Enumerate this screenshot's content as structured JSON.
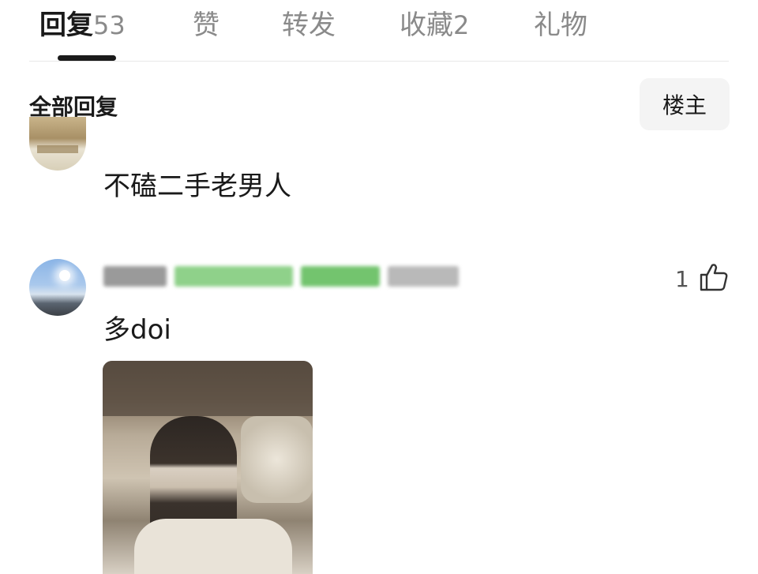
{
  "tabs": [
    {
      "label": "回复",
      "count": "53",
      "active": true
    },
    {
      "label": "赞",
      "count": "",
      "active": false
    },
    {
      "label": "转发",
      "count": "",
      "active": false
    },
    {
      "label": "收藏",
      "count": "2",
      "active": false
    },
    {
      "label": "礼物",
      "count": "",
      "active": false
    }
  ],
  "section": {
    "title": "全部回复",
    "op_button": "楼主"
  },
  "comments": [
    {
      "text": "不磕二手老男人",
      "likes": ""
    },
    {
      "text": "多doi",
      "likes": "1",
      "like_icon": "thumbs-up-icon"
    }
  ],
  "colors": {
    "active_tab": "#1a1a1a",
    "inactive_tab": "#8a8a8a",
    "button_bg": "#f4f4f4"
  }
}
